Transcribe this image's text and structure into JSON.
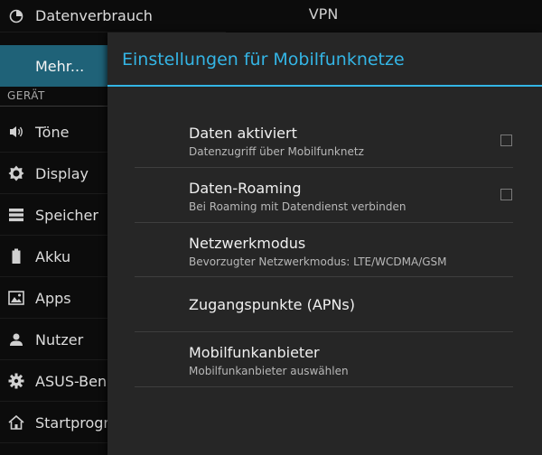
{
  "sidebar": {
    "section_header": "GERÄT",
    "items": [
      {
        "label": "Datenverbrauch",
        "icon": "pie-chart-icon"
      },
      {
        "label": "Mehr...",
        "icon": ""
      },
      {
        "label": "Töne",
        "icon": "speaker-icon"
      },
      {
        "label": "Display",
        "icon": "brightness-icon"
      },
      {
        "label": "Speicher",
        "icon": "storage-icon"
      },
      {
        "label": "Akku",
        "icon": "battery-icon"
      },
      {
        "label": "Apps",
        "icon": "apps-icon"
      },
      {
        "label": "Nutzer",
        "icon": "user-icon"
      },
      {
        "label": "ASUS-Benu",
        "icon": "gear-icon"
      },
      {
        "label": "Startprogra",
        "icon": "home-icon"
      }
    ]
  },
  "background": {
    "vpn_label": "VPN"
  },
  "dialog": {
    "title": "Einstellungen für Mobilfunknetze",
    "accent_color": "#33b5e5",
    "rows": [
      {
        "title": "Daten aktiviert",
        "subtitle": "Datenzugriff über Mobilfunknetz",
        "checkbox": true,
        "checked": false
      },
      {
        "title": "Daten-Roaming",
        "subtitle": "Bei Roaming mit Datendienst verbinden",
        "checkbox": true,
        "checked": false
      },
      {
        "title": "Netzwerkmodus",
        "subtitle": "Bevorzugter Netzwerkmodus: LTE/WCDMA/GSM",
        "checkbox": false
      },
      {
        "title": "Zugangspunkte (APNs)",
        "subtitle": "",
        "checkbox": false
      },
      {
        "title": "Mobilfunkanbieter",
        "subtitle": "Mobilfunkanbieter auswählen",
        "checkbox": false
      }
    ]
  }
}
